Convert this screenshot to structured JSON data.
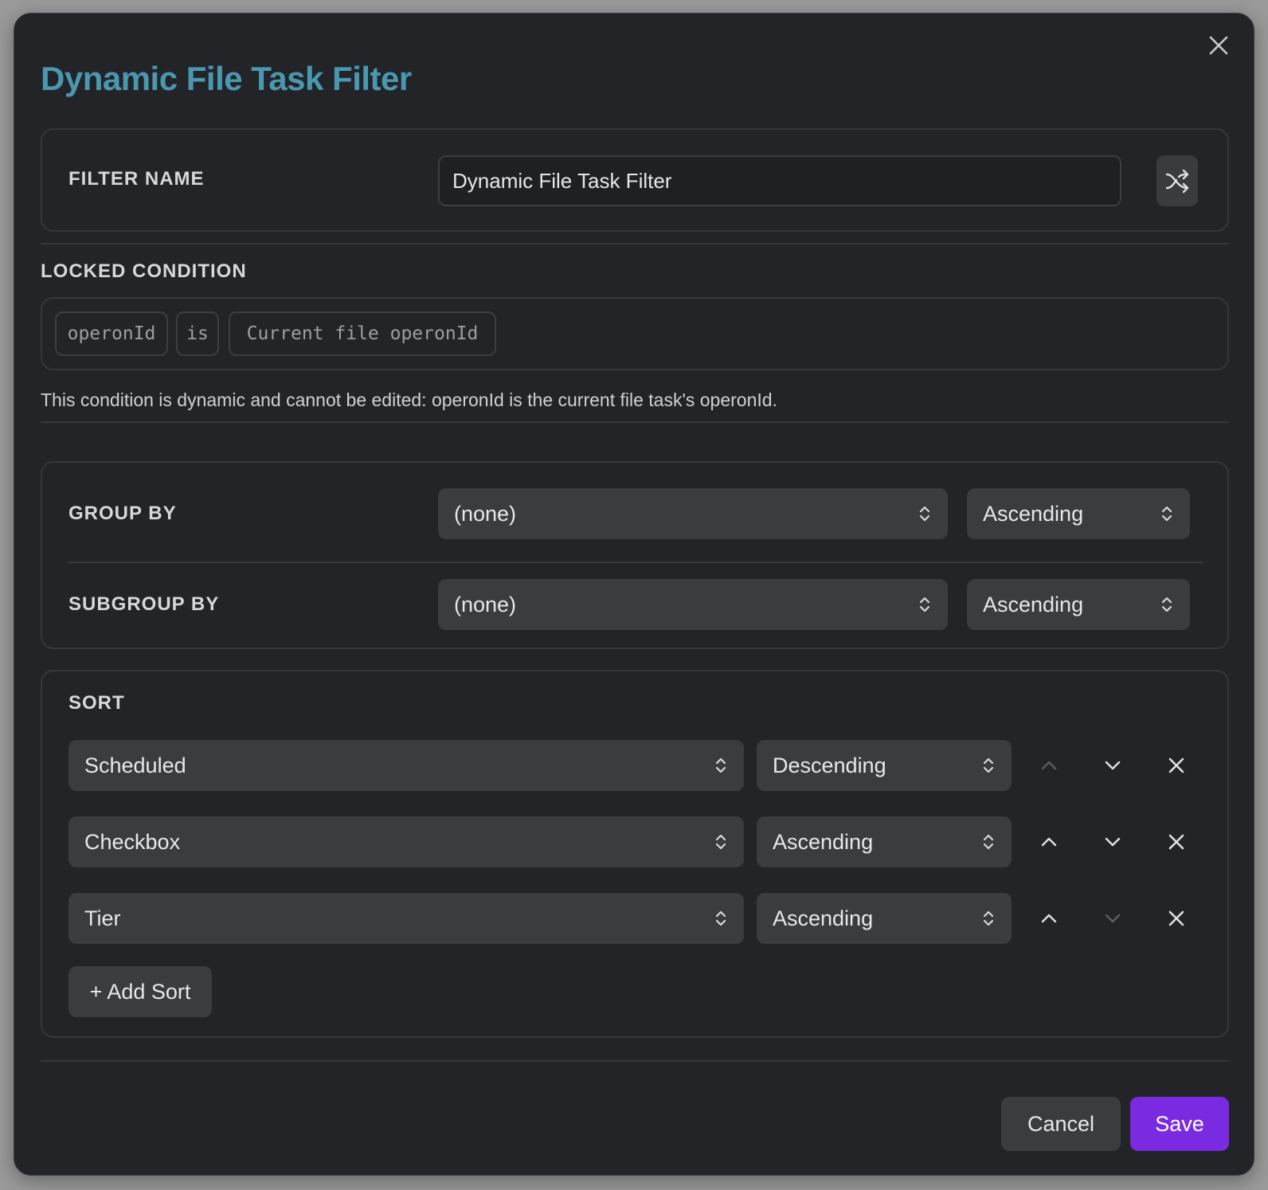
{
  "dialog": {
    "title": "Dynamic File Task Filter",
    "accent_color": "#4a98b0",
    "close_icon": "close-icon"
  },
  "filter_name": {
    "label": "FILTER NAME",
    "value": "Dynamic File Task Filter",
    "action_icon": "shuffle-icon"
  },
  "locked_condition": {
    "label": "LOCKED CONDITION",
    "field": "operonId",
    "operator": "is",
    "value": "Current file operonId",
    "help": "This condition is dynamic and cannot be edited: operonId is the current file task's operonId."
  },
  "grouping": {
    "group_by": {
      "label": "GROUP BY",
      "value": "(none)",
      "order": "Ascending"
    },
    "subgroup_by": {
      "label": "SUBGROUP BY",
      "value": "(none)",
      "order": "Ascending"
    }
  },
  "sort": {
    "label": "SORT",
    "rows": [
      {
        "field": "Scheduled",
        "order": "Descending",
        "up_enabled": false,
        "down_enabled": true
      },
      {
        "field": "Checkbox",
        "order": "Ascending",
        "up_enabled": true,
        "down_enabled": true
      },
      {
        "field": "Tier",
        "order": "Ascending",
        "up_enabled": true,
        "down_enabled": false
      }
    ],
    "add_label": "+ Add Sort"
  },
  "footer": {
    "cancel_label": "Cancel",
    "save_label": "Save",
    "save_color": "#7a2be2"
  }
}
